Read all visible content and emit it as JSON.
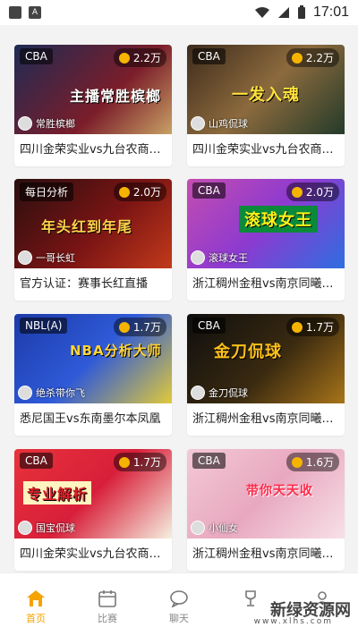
{
  "status_bar": {
    "time": "17:01"
  },
  "cards": [
    {
      "tag": "CBA",
      "views": "2.2万",
      "anchor": "常胜槟榔",
      "art_text": "主播常胜槟榔",
      "title": "四川金荣实业vs九台农商…"
    },
    {
      "tag": "CBA",
      "views": "2.2万",
      "anchor": "山鸡侃球",
      "art_text": "一发入魂",
      "title": "四川金荣实业vs九台农商…"
    },
    {
      "tag": "每日分析",
      "views": "2.0万",
      "anchor": "一哥长虹",
      "art_text": "年头红到年尾",
      "title": "官方认证：赛事长红直播"
    },
    {
      "tag": "CBA",
      "views": "2.0万",
      "anchor": "滚球女王",
      "art_text": "滚球女王",
      "title": "浙江稠州金租vs南京同曦…"
    },
    {
      "tag": "NBL(A)",
      "views": "1.7万",
      "anchor": "绝杀带你飞",
      "art_text": "NBA分析大师",
      "title": "悉尼国王vs东南墨尔本凤凰"
    },
    {
      "tag": "CBA",
      "views": "1.7万",
      "anchor": "金刀侃球",
      "art_text": "金刀侃球",
      "title": "浙江稠州金租vs南京同曦…"
    },
    {
      "tag": "CBA",
      "views": "1.7万",
      "anchor": "国宝侃球",
      "art_text": "专业解析",
      "title": "四川金荣实业vs九台农商…"
    },
    {
      "tag": "CBA",
      "views": "1.6万",
      "anchor": "小仙女",
      "art_text": "带你天天收",
      "title": "浙江稠州金租vs南京同曦…"
    }
  ],
  "tabbar": {
    "tabs": [
      {
        "label": "首页",
        "icon": "home-icon"
      },
      {
        "label": "比赛",
        "icon": "calendar-icon"
      },
      {
        "label": "聊天",
        "icon": "chat-icon"
      },
      {
        "label": "",
        "icon": "trophy-icon"
      },
      {
        "label": "",
        "icon": "profile-icon"
      }
    ]
  },
  "watermark": {
    "main": "新绿资源网",
    "sub": "www.xlhs.com"
  },
  "colors": {
    "accent": "#f5a300",
    "background": "#f3f3f3"
  }
}
